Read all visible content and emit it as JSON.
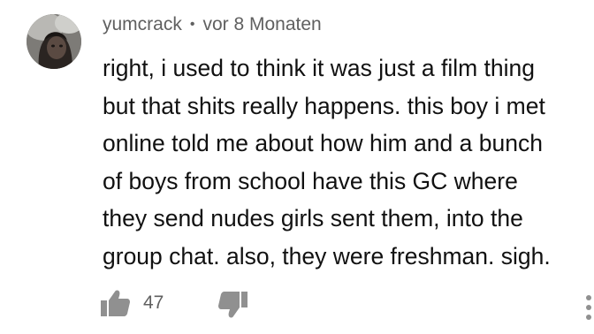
{
  "comment": {
    "author": "yumcrack",
    "separator": "•",
    "timestamp": "vor 8 Monaten",
    "text_lines": [
      "right, i used to think it was just a film thing",
      "but that shits really happens. this boy i met",
      "online told me about how him and a bunch",
      "of boys from school have this GC where",
      "they send nudes girls sent them, into the",
      "group chat. also, they were freshman. sigh."
    ],
    "like_count": "47"
  },
  "icons": {
    "like": "thumbs-up-icon",
    "dislike": "thumbs-down-icon",
    "more": "more-vertical-icon"
  },
  "colors": {
    "text": "#111111",
    "meta": "#606060",
    "icon": "#909090"
  }
}
